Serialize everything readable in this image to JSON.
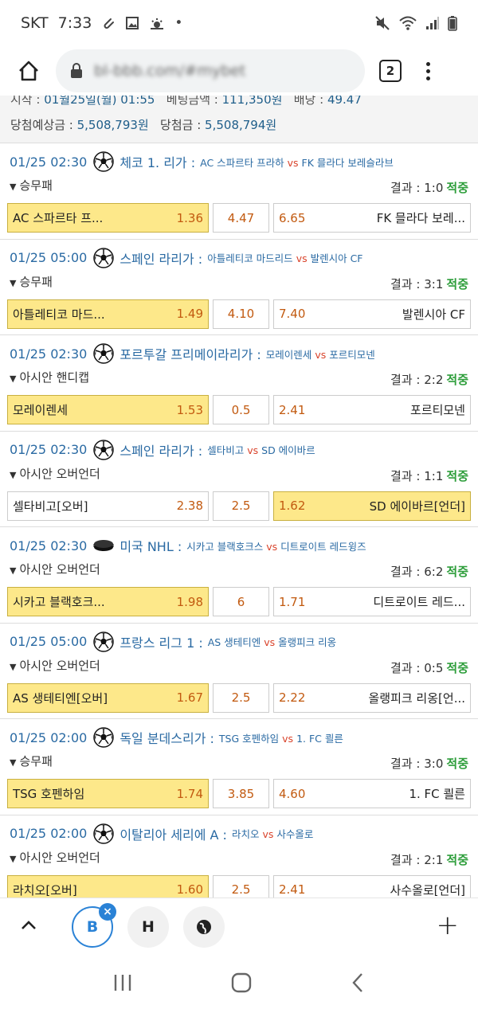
{
  "status_bar": {
    "carrier": "SKT",
    "time": "7:33",
    "dot": "•"
  },
  "browser": {
    "url": "bl-bbb.com/#mybet",
    "tab_count": "2"
  },
  "summary": {
    "line1_label1": "시작 : ",
    "line1_value1": "01월25일(월) 01:55",
    "line1_label2": "베팅금액 : ",
    "line1_value2": "111,350원",
    "line1_label3": "배당 : ",
    "line1_value3": "49.47",
    "line2_label1": "당첨예상금 : ",
    "line2_value1": "5,508,793원",
    "line2_label2": "당첨금 : ",
    "line2_value2": "5,508,794원"
  },
  "vs_label": "vs",
  "result_label": "결과 : ",
  "matches": [
    {
      "date": "01/25 02:30",
      "sport": "soccer",
      "league": "체코 1. 리가 :",
      "home_team": "AC 스파르타 프라하",
      "away_team": "FK 믈라다 보레슬라브",
      "bet_type": "승무패",
      "result": "1:0",
      "status": "적중",
      "home_label": "AC 스파르타 프...",
      "home_odd": "1.36",
      "mid": "4.47",
      "away_odd": "6.65",
      "away_label": "FK 믈라다 보레...",
      "selected": "home"
    },
    {
      "date": "01/25 05:00",
      "sport": "soccer",
      "league": "스페인 라리가 :",
      "home_team": "아틀레티코 마드리드",
      "away_team": "발렌시아 CF",
      "bet_type": "승무패",
      "result": "3:1",
      "status": "적중",
      "home_label": "아틀레티코 마드...",
      "home_odd": "1.49",
      "mid": "4.10",
      "away_odd": "7.40",
      "away_label": "발렌시아 CF",
      "selected": "home"
    },
    {
      "date": "01/25 02:30",
      "sport": "soccer",
      "league": "포르투갈 프리메이라리가 :",
      "home_team": "모레이렌세",
      "away_team": "포르티모넨",
      "bet_type": "아시안 핸디캡",
      "result": "2:2",
      "status": "적중",
      "home_label": "모레이렌세",
      "home_odd": "1.53",
      "mid": "0.5",
      "away_odd": "2.41",
      "away_label": "포르티모넨",
      "selected": "home"
    },
    {
      "date": "01/25 02:30",
      "sport": "soccer",
      "league": "스페인 라리가 :",
      "home_team": "셀타비고",
      "away_team": "SD 에이바르",
      "bet_type": "아시안 오버언더",
      "result": "1:1",
      "status": "적중",
      "home_label": "셀타비고[오버]",
      "home_odd": "2.38",
      "mid": "2.5",
      "away_odd": "1.62",
      "away_label": "SD 에이바르[언더]",
      "selected": "away"
    },
    {
      "date": "01/25 02:30",
      "sport": "hockey",
      "league": "미국 NHL :",
      "home_team": "시카고 블랙호크스",
      "away_team": "디트로이트 레드윙즈",
      "bet_type": "아시안 오버언더",
      "result": "6:2",
      "status": "적중",
      "home_label": "시카고 블랙호크...",
      "home_odd": "1.98",
      "mid": "6",
      "away_odd": "1.71",
      "away_label": "디트로이트 레드...",
      "selected": "home"
    },
    {
      "date": "01/25 05:00",
      "sport": "soccer",
      "league": "프랑스 리그 1 :",
      "home_team": "AS 생테티엔",
      "away_team": "올랭피크 리옹",
      "bet_type": "아시안 오버언더",
      "result": "0:5",
      "status": "적중",
      "home_label": "AS 생테티엔[오버]",
      "home_odd": "1.67",
      "mid": "2.5",
      "away_odd": "2.22",
      "away_label": "올랭피크 리옹[언...",
      "selected": "home"
    },
    {
      "date": "01/25 02:00",
      "sport": "soccer",
      "league": "독일 분데스리가 :",
      "home_team": "TSG 호펜하임",
      "away_team": "1. FC 쾰른",
      "bet_type": "승무패",
      "result": "3:0",
      "status": "적중",
      "home_label": "TSG 호펜하임",
      "home_odd": "1.74",
      "mid": "3.85",
      "away_odd": "4.60",
      "away_label": "1. FC 쾰른",
      "selected": "home"
    },
    {
      "date": "01/25 02:00",
      "sport": "soccer",
      "league": "이탈리아 세리에 A :",
      "home_team": "라치오",
      "away_team": "사수올로",
      "bet_type": "아시안 오버언더",
      "result": "2:1",
      "status": "적중",
      "home_label": "라치오[오버]",
      "home_odd": "1.60",
      "mid": "2.5",
      "away_odd": "2.41",
      "away_label": "사수올로[언더]",
      "selected": "home"
    }
  ],
  "bottom_bar": {
    "tab1": "B",
    "tab2": "H",
    "close": "×",
    "plus": "+"
  },
  "colors": {
    "selected_bg": "#fde88a",
    "odd": "#c25a10",
    "link": "#2a6aa3",
    "hit": "#2e9e3b",
    "accent": "#2a82d6"
  }
}
